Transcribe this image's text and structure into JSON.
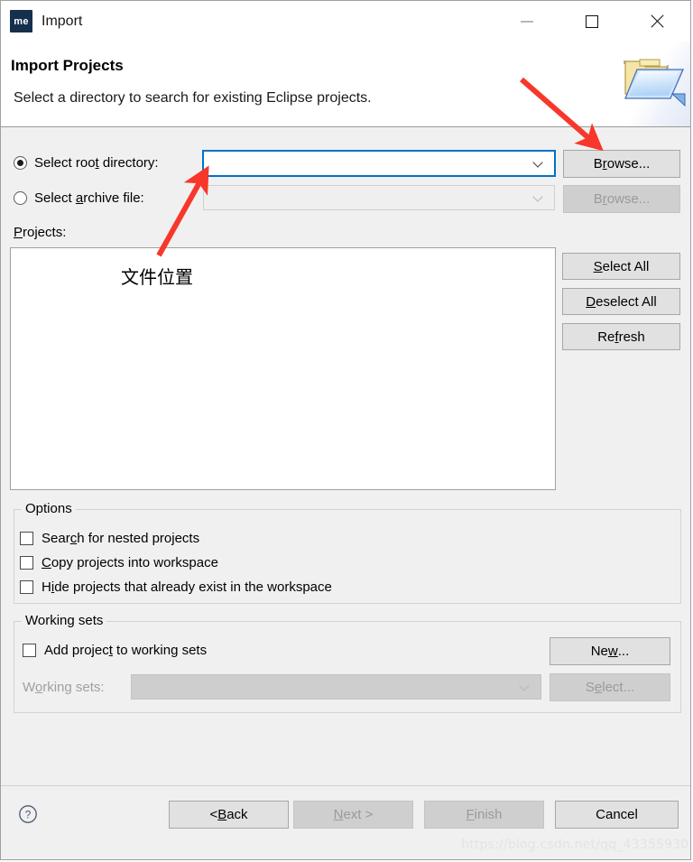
{
  "window": {
    "title": "Import",
    "app_icon_text": "me",
    "controls": {
      "minimize": "minimize-button",
      "maximize": "maximize-button",
      "close": "close-button"
    }
  },
  "banner": {
    "title": "Import Projects",
    "subtitle": "Select a directory to search for existing Eclipse projects.",
    "icon": "open-folder-icon"
  },
  "source": {
    "root_directory": {
      "label_before": "Select roo",
      "label_mnemonic": "t",
      "label_after": " directory:",
      "value": "",
      "selected": true,
      "browse_label_before": "B",
      "browse_mnemonic": "r",
      "browse_label_after": "owse...",
      "browse_enabled": true
    },
    "archive_file": {
      "label_before": "Select ",
      "label_mnemonic": "a",
      "label_after": "rchive file:",
      "value": "",
      "selected": false,
      "browse_label_before": "B",
      "browse_mnemonic": "r",
      "browse_label_after": "owse...",
      "browse_enabled": false
    }
  },
  "projects": {
    "label_mnemonic": "P",
    "label_after": "rojects:",
    "items": [],
    "annotation": "文件位置",
    "buttons": [
      {
        "before": "",
        "mnemonic": "S",
        "after": "elect All",
        "enabled": true,
        "name": "select-all-button"
      },
      {
        "before": "",
        "mnemonic": "D",
        "after": "eselect All",
        "enabled": true,
        "name": "deselect-all-button"
      },
      {
        "before": "Re",
        "mnemonic": "f",
        "after": "resh",
        "enabled": true,
        "name": "refresh-button"
      }
    ]
  },
  "options": {
    "group_title": "Options",
    "checkboxes": [
      {
        "before": "Sear",
        "mnemonic": "c",
        "after": "h for nested projects",
        "checked": false,
        "name": "checkbox-search-nested"
      },
      {
        "before": "",
        "mnemonic": "C",
        "after": "opy projects into workspace",
        "checked": false,
        "name": "checkbox-copy-into-workspace"
      },
      {
        "before": "H",
        "mnemonic": "i",
        "after": "de projects that already exist in the workspace",
        "checked": false,
        "name": "checkbox-hide-existing"
      }
    ]
  },
  "working_sets": {
    "group_title": "Working sets",
    "add_checkbox": {
      "before": "Add projec",
      "mnemonic": "t",
      "after": " to working sets",
      "checked": false
    },
    "new_button": {
      "before": "Ne",
      "mnemonic": "w",
      "after": "...",
      "enabled": true
    },
    "combo_label": {
      "before": "W",
      "mnemonic": "o",
      "after": "rking sets:",
      "enabled": false
    },
    "combo_value": "",
    "select_button": {
      "before": "S",
      "mnemonic": "e",
      "after": "lect...",
      "enabled": false
    }
  },
  "footer": {
    "help": "help-icon",
    "buttons": [
      {
        "before": "< ",
        "mnemonic": "B",
        "after": "ack",
        "enabled": true,
        "name": "back-button"
      },
      {
        "before": "",
        "mnemonic": "N",
        "after": "ext >",
        "enabled": false,
        "name": "next-button"
      },
      {
        "before": "",
        "mnemonic": "F",
        "after": "inish",
        "enabled": false,
        "name": "finish-button"
      },
      {
        "before": "Cancel",
        "mnemonic": "",
        "after": "",
        "enabled": true,
        "name": "cancel-button"
      }
    ]
  },
  "watermark": "https://blog.csdn.net/qq_43355930",
  "annotations": {
    "arrow_color": "#f8372c",
    "arrow_to_browse": "arrow-pointing-to-browse-button",
    "arrow_to_directory_field": "arrow-pointing-to-root-directory-field"
  }
}
